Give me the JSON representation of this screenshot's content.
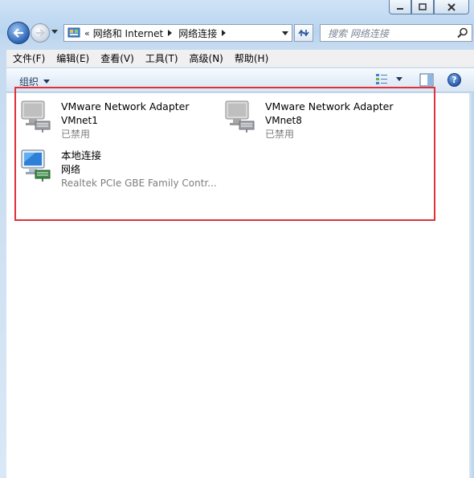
{
  "window": {
    "caption": {
      "minimize_icon": "minimize-icon",
      "maximize_icon": "maximize-icon",
      "close_icon": "close-icon"
    }
  },
  "navigation": {
    "address": {
      "overflow_chevron": "«",
      "crumbs": [
        "网络和 Internet",
        "网络连接"
      ]
    },
    "search": {
      "placeholder": "搜索 网络连接"
    }
  },
  "menu": {
    "items": [
      "文件(F)",
      "编辑(E)",
      "查看(V)",
      "工具(T)",
      "高级(N)",
      "帮助(H)"
    ]
  },
  "command_bar": {
    "organize_label": "组织",
    "help_label": "?"
  },
  "adapters": [
    {
      "name": "VMware Network Adapter",
      "sub": "VMnet1",
      "status": "已禁用",
      "icon": "disabled-network-adapter-icon"
    },
    {
      "name": "VMware Network Adapter",
      "sub": "VMnet8",
      "status": "已禁用",
      "icon": "disabled-network-adapter-icon"
    },
    {
      "name": "本地连接",
      "sub": "网络",
      "status": "Realtek PCIe GBE Family Contr...",
      "icon": "network-adapter-icon"
    }
  ],
  "colors": {
    "highlight_box": "#e0303a",
    "disabled_text": "#7d7d7d",
    "menu_bg": "#f0f0f0"
  }
}
